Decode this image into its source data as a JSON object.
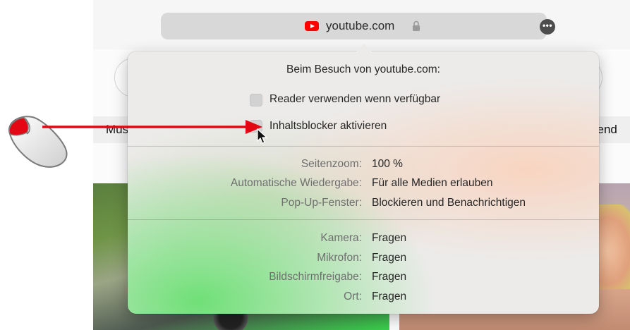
{
  "browser": {
    "url": "youtube.com",
    "search_chip_left": "Mus",
    "search_chip_right": "send"
  },
  "popover": {
    "title": "Beim Besuch von youtube.com:",
    "checkboxes": [
      {
        "label": "Reader verwenden wenn verfügbar",
        "checked": false
      },
      {
        "label": "Inhaltsblocker aktivieren",
        "checked": false
      }
    ],
    "settings": [
      {
        "key": "Seitenzoom:",
        "value": "100 %"
      },
      {
        "key": "Automatische Wiedergabe:",
        "value": "Für alle Medien erlauben"
      },
      {
        "key": "Pop-Up-Fenster:",
        "value": "Blockieren und Benachrichtigen"
      }
    ],
    "permissions": [
      {
        "key": "Kamera:",
        "value": "Fragen"
      },
      {
        "key": "Mikrofon:",
        "value": "Fragen"
      },
      {
        "key": "Bildschirmfreigabe:",
        "value": "Fragen"
      },
      {
        "key": "Ort:",
        "value": "Fragen"
      }
    ]
  },
  "icons": {
    "site_icon": "youtube-logo-icon",
    "lock": "lock-icon",
    "more": "more-options-icon",
    "mouse": "mouse-left-click-icon",
    "arrow": "red-arrow-icon",
    "cursor": "pointer-cursor-icon"
  },
  "colors": {
    "youtube_red": "#ff0000",
    "annotation_red": "#e30613",
    "popover_bg": "#ecebea"
  }
}
